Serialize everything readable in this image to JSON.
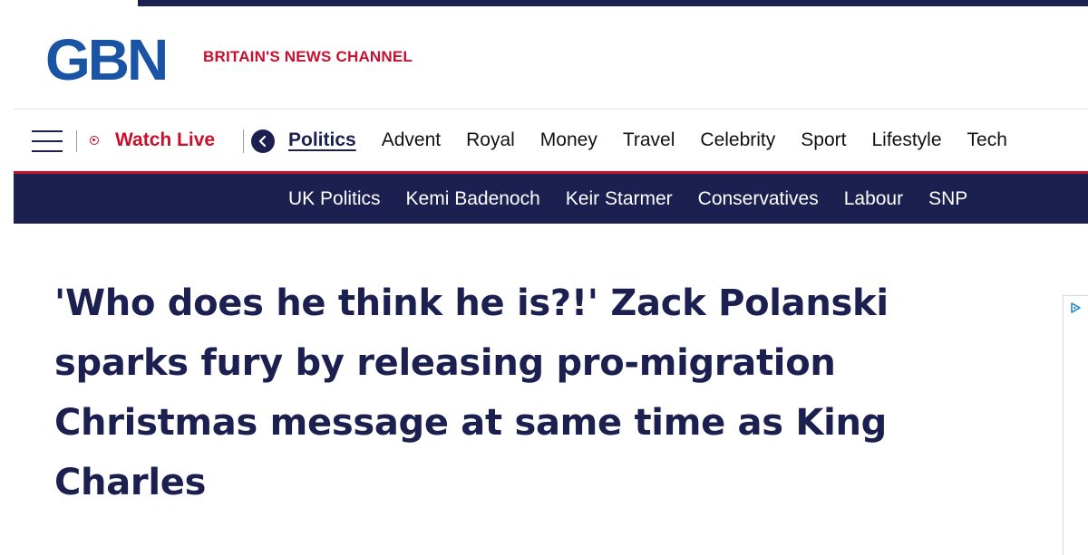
{
  "brand": {
    "logo_text": "GBN",
    "tagline": "BRITAIN'S NEWS CHANNEL",
    "colors": {
      "navy": "#1b2050",
      "red": "#c8102e",
      "blue": "#1a54a4"
    }
  },
  "nav": {
    "menu_icon": "hamburger-menu-icon",
    "watch_live": {
      "icon": "live-record-icon",
      "label": "Watch Live"
    },
    "back_icon": "chevron-left-icon",
    "items": [
      {
        "label": "Politics",
        "active": true
      },
      {
        "label": "Advent"
      },
      {
        "label": "Royal"
      },
      {
        "label": "Money"
      },
      {
        "label": "Travel"
      },
      {
        "label": "Celebrity"
      },
      {
        "label": "Sport"
      },
      {
        "label": "Lifestyle"
      },
      {
        "label": "Tech"
      }
    ]
  },
  "subnav": {
    "items": [
      {
        "label": "UK Politics"
      },
      {
        "label": "Kemi Badenoch"
      },
      {
        "label": "Keir Starmer"
      },
      {
        "label": "Conservatives"
      },
      {
        "label": "Labour"
      },
      {
        "label": "SNP"
      }
    ]
  },
  "article": {
    "headline": "'Who does he think he is?!' Zack Polanski sparks fury by releasing pro-migration Christmas message at same time as King Charles"
  },
  "ad": {
    "icon": "adchoices-icon"
  }
}
